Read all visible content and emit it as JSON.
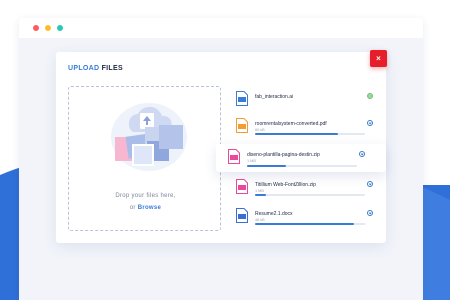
{
  "window": {
    "controls": [
      "close",
      "minimize",
      "maximize"
    ]
  },
  "upload": {
    "title_accent": "UPLOAD",
    "title_rest": "FILES",
    "close_label": "×",
    "dropzone": {
      "line1": "Drop your files here,",
      "or": "or",
      "browse": "Browse"
    },
    "files": [
      {
        "name": "fab_interaction.ai",
        "size": "",
        "type": "ai",
        "color": "#3a7bd5",
        "progress": 1.0,
        "status": "done"
      },
      {
        "name": "roomrentalsystem-converted.pdf",
        "size": "60 kB",
        "type": "pdf",
        "color": "#f39c33",
        "progress": 0.75,
        "status": "uploading"
      },
      {
        "name": "diseno-plantilla-pagina-destin.zip",
        "size": "1 MB",
        "type": "zip",
        "color": "#e84a9b",
        "progress": 0.35,
        "status": "uploading"
      },
      {
        "name": "Titillium Web-FontZillion.zip",
        "size": "1 MB",
        "type": "zip",
        "color": "#e84a9b",
        "progress": 0.1,
        "status": "uploading"
      },
      {
        "name": "Resume2.1.docx",
        "size": "48 kB",
        "type": "doc",
        "color": "#3a6fd0",
        "progress": 0.9,
        "status": "uploading"
      }
    ]
  },
  "colors": {
    "accent": "#3a7bd5",
    "close": "#e61e2a",
    "background_wave": "#2f6fd8"
  }
}
